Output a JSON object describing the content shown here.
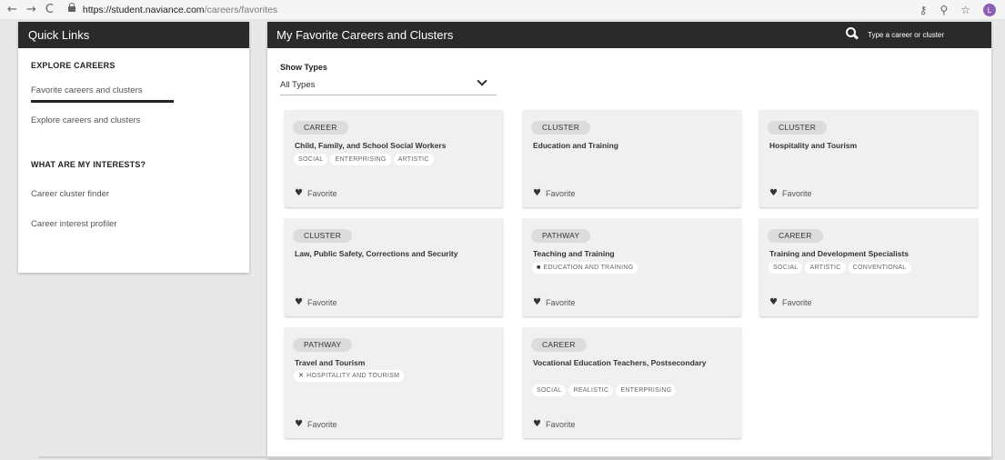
{
  "browser": {
    "back": "←",
    "forward": "→",
    "reload": "C",
    "url_host": "https://student.naviance.com",
    "url_path": "/careers/favorites",
    "profile_initial": "L"
  },
  "quick_links": {
    "title": "Quick Links",
    "sections": [
      {
        "heading": "EXPLORE CAREERS",
        "items": [
          "Favorite careers and clusters",
          "Explore careers and clusters"
        ],
        "active_index": 0
      },
      {
        "heading": "WHAT ARE MY INTERESTS?",
        "items": [
          "Career cluster finder",
          "Career interest profiler"
        ]
      }
    ]
  },
  "main": {
    "title": "My Favorite Careers and Clusters",
    "search_placeholder": "Type a career or cluster",
    "filter": {
      "label": "Show Types",
      "value": "All Types"
    },
    "favorite_label": "Favorite",
    "cards": [
      {
        "type": "CAREER",
        "title": "Child, Family, and School Social Workers",
        "tags": [
          "SOCIAL",
          "ENTERPRISING",
          "ARTISTIC"
        ]
      },
      {
        "type": "CLUSTER",
        "title": "Education and Training",
        "tags": []
      },
      {
        "type": "CLUSTER",
        "title": "Hospitality and Tourism",
        "tags": []
      },
      {
        "type": "CLUSTER",
        "title": "Law, Public Safety, Corrections and Security",
        "tags": []
      },
      {
        "type": "PATHWAY",
        "title": "Teaching and Training",
        "tags": [
          "EDUCATION AND TRAINING"
        ],
        "tag_icon": "book-icon"
      },
      {
        "type": "CAREER",
        "title": "Training and Development Specialists",
        "tags": [
          "SOCIAL",
          "ARTISTIC",
          "CONVENTIONAL"
        ]
      },
      {
        "type": "PATHWAY",
        "title": "Travel and Tourism",
        "tags": [
          "HOSPITALITY AND TOURISM"
        ],
        "tag_icon": "cross-utensils-icon"
      },
      {
        "type": "CAREER",
        "title": "Vocational Education Teachers, Postsecondary",
        "tags": [
          "SOCIAL",
          "REALISTIC",
          "ENTERPRISING"
        ]
      }
    ]
  }
}
